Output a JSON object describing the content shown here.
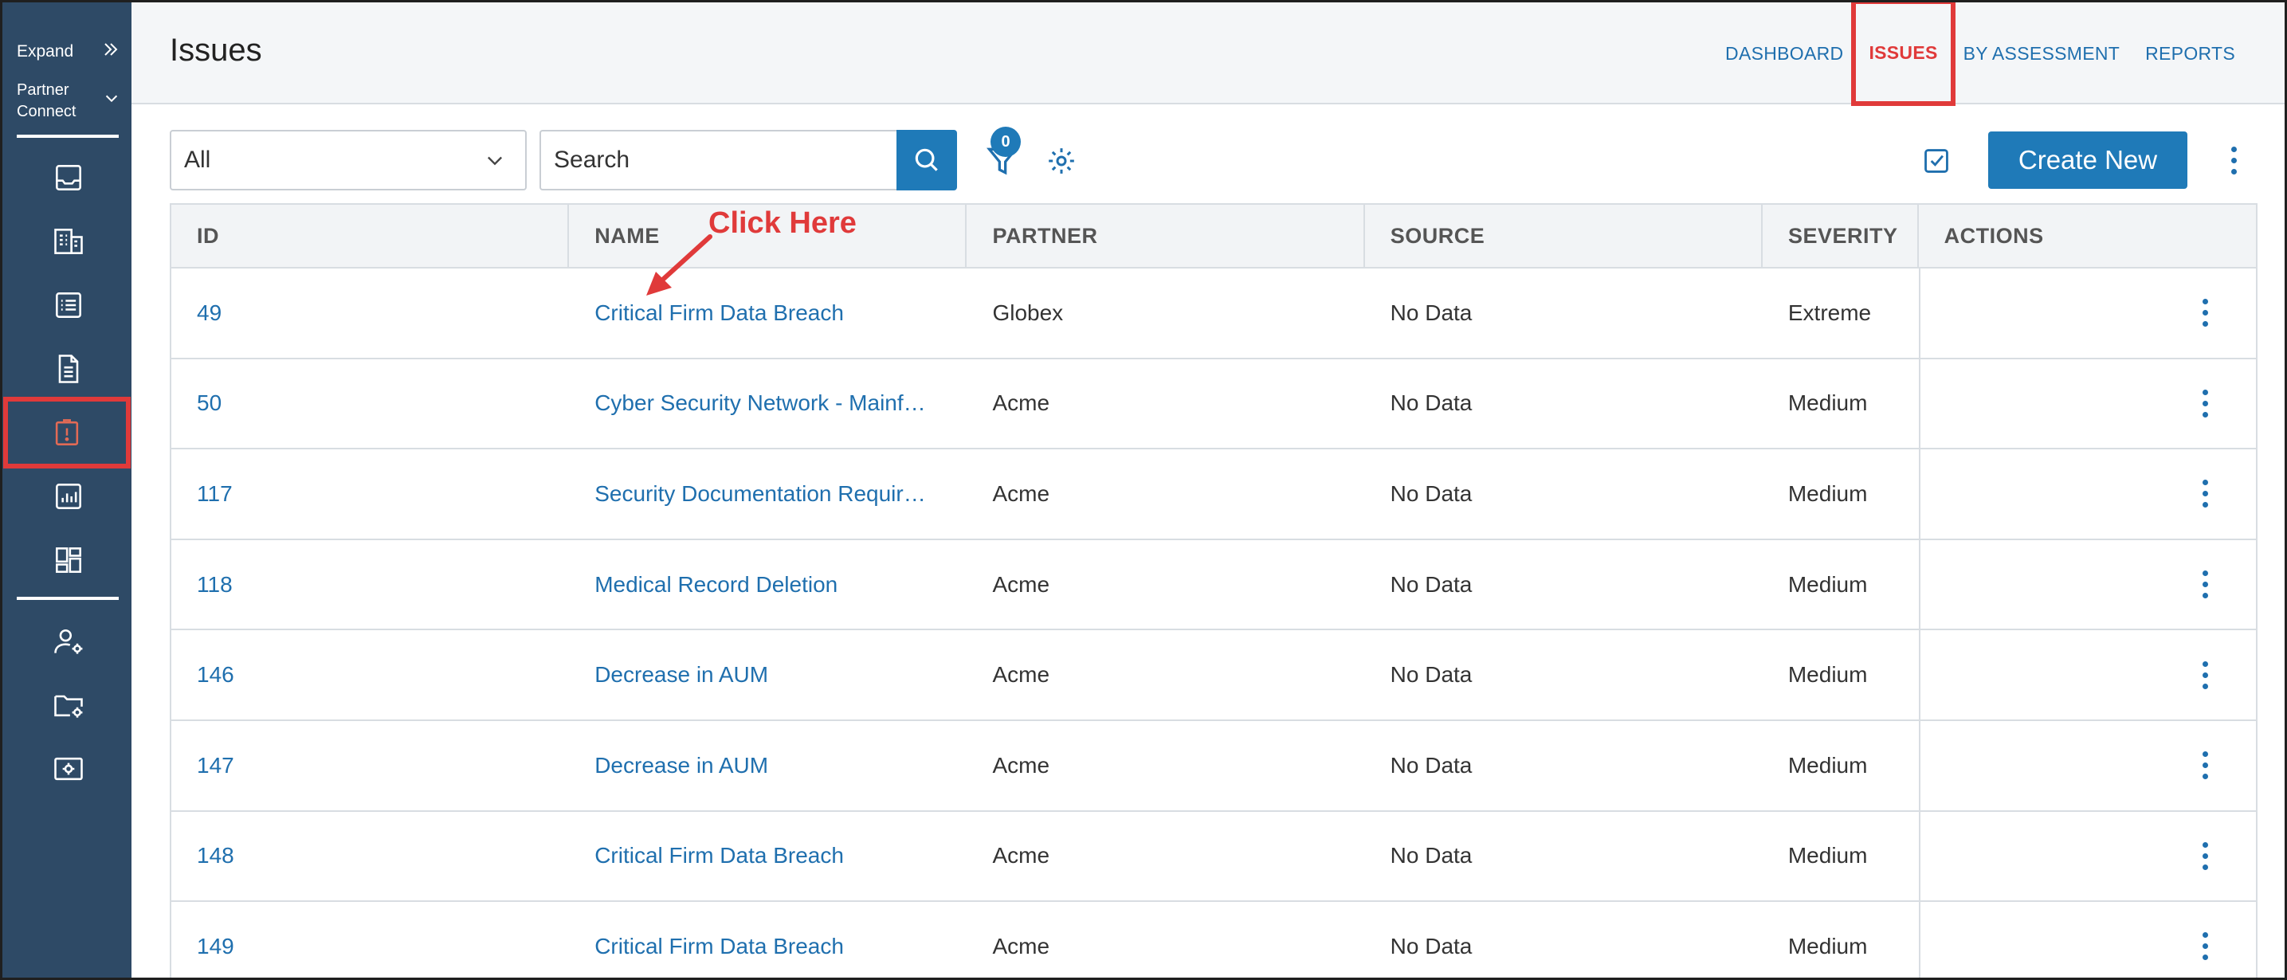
{
  "sidebar": {
    "expand_label": "Expand",
    "org_label": "Partner\nConnect",
    "items": [
      {
        "name": "inbox-icon"
      },
      {
        "name": "building-icon"
      },
      {
        "name": "checklist-icon"
      },
      {
        "name": "document-icon"
      },
      {
        "name": "issue-icon",
        "active": true
      },
      {
        "name": "report-chart-icon"
      },
      {
        "name": "dashboard-grid-icon"
      },
      {
        "name": "user-settings-icon"
      },
      {
        "name": "folder-settings-icon"
      },
      {
        "name": "system-settings-icon"
      }
    ]
  },
  "header": {
    "title": "Issues",
    "nav": [
      {
        "label": "DASHBOARD"
      },
      {
        "label": "ISSUES",
        "active": true
      },
      {
        "label": "BY ASSESSMENT"
      },
      {
        "label": "REPORTS"
      }
    ]
  },
  "toolbar": {
    "filter_select_value": "All",
    "search_placeholder": "Search",
    "filter_count": "0",
    "create_label": "Create New"
  },
  "table": {
    "columns": [
      "ID",
      "NAME",
      "PARTNER",
      "SOURCE",
      "SEVERITY",
      "ACTIONS"
    ],
    "rows": [
      {
        "id": "49",
        "name": "Critical Firm Data Breach",
        "partner": "Globex",
        "source": "No Data",
        "severity": "Extreme"
      },
      {
        "id": "50",
        "name": "Cyber Security Network - Mainf…",
        "partner": "Acme",
        "source": "No Data",
        "severity": "Medium"
      },
      {
        "id": "117",
        "name": "Security Documentation Requir…",
        "partner": "Acme",
        "source": "No Data",
        "severity": "Medium"
      },
      {
        "id": "118",
        "name": "Medical Record Deletion",
        "partner": "Acme",
        "source": "No Data",
        "severity": "Medium"
      },
      {
        "id": "146",
        "name": "Decrease in AUM",
        "partner": "Acme",
        "source": "No Data",
        "severity": "Medium"
      },
      {
        "id": "147",
        "name": "Decrease in AUM",
        "partner": "Acme",
        "source": "No Data",
        "severity": "Medium"
      },
      {
        "id": "148",
        "name": "Critical Firm Data Breach",
        "partner": "Acme",
        "source": "No Data",
        "severity": "Medium"
      },
      {
        "id": "149",
        "name": "Critical Firm Data Breach",
        "partner": "Acme",
        "source": "No Data",
        "severity": "Medium"
      }
    ]
  },
  "annotation": {
    "text": "Click Here"
  },
  "colors": {
    "sidebar_bg": "#2e4a66",
    "accent": "#1f7ab8",
    "link": "#1f6fae",
    "highlight": "#e03a3a"
  }
}
